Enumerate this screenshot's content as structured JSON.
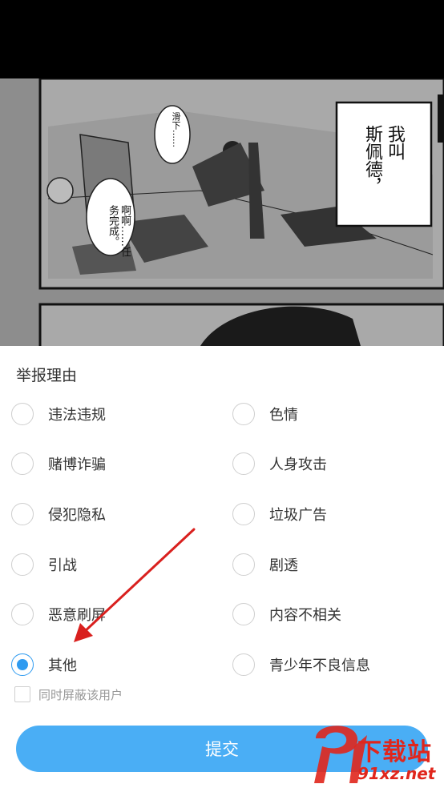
{
  "manga": {
    "bubble_1": "滑下……",
    "bubble_2": "啊啊……任务完成。",
    "caption_col1": "我叫",
    "caption_col2": "斯佩德，"
  },
  "sheet": {
    "title": "举报理由",
    "options_left": [
      {
        "label": "违法违规",
        "checked": false
      },
      {
        "label": "赌博诈骗",
        "checked": false
      },
      {
        "label": "侵犯隐私",
        "checked": false
      },
      {
        "label": "引战",
        "checked": false
      },
      {
        "label": "恶意刷屏",
        "checked": false
      },
      {
        "label": "其他",
        "checked": true
      }
    ],
    "options_right": [
      {
        "label": "色情",
        "checked": false
      },
      {
        "label": "人身攻击",
        "checked": false
      },
      {
        "label": "垃圾广告",
        "checked": false
      },
      {
        "label": "剧透",
        "checked": false
      },
      {
        "label": "内容不相关",
        "checked": false
      },
      {
        "label": "青少年不良信息",
        "checked": false
      }
    ],
    "block_user_label": "同时屏蔽该用户",
    "submit_label": "提交"
  },
  "watermark": {
    "logo_text": "下载站",
    "url_text": "91xz.net"
  },
  "colors": {
    "accent": "#2f9bf0",
    "button": "#4aaef5",
    "arrow": "#d9201e",
    "watermark": "#e0261c"
  }
}
